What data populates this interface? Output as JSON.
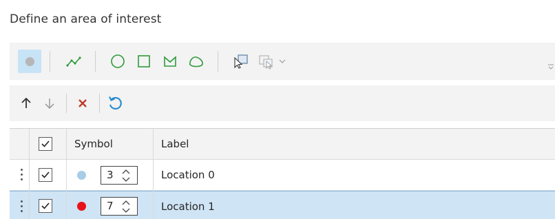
{
  "panel": {
    "title": "Define an area of interest"
  },
  "toolbar": {
    "tools": [
      {
        "name": "point-tool",
        "icon": "point-icon",
        "selected": true
      },
      {
        "name": "line-tool",
        "icon": "polyline-icon"
      },
      {
        "name": "circle-tool",
        "icon": "circle-icon"
      },
      {
        "name": "rectangle-tool",
        "icon": "rectangle-icon"
      },
      {
        "name": "polygon-tool",
        "icon": "polygon-icon"
      },
      {
        "name": "freehand-tool",
        "icon": "freehand-icon"
      },
      {
        "name": "select-tool",
        "icon": "select-icon"
      },
      {
        "name": "select-dropdown-tool",
        "icon": "select-by-shape-icon"
      }
    ],
    "accent": "#c7e3f6"
  },
  "actions": {
    "move_up": "arrow-up-icon",
    "move_down": "arrow-down-icon",
    "delete": "delete-icon",
    "reset": "undo-icon"
  },
  "table": {
    "columns": {
      "symbol": "Symbol",
      "label": "Label"
    },
    "rows": [
      {
        "checked": true,
        "color": "#a8cde6",
        "size": "3",
        "label": "Location 0",
        "selected": false
      },
      {
        "checked": true,
        "color": "#e8121a",
        "size": "7",
        "label": "Location 1",
        "selected": true
      }
    ]
  },
  "colors": {
    "selected_row": "#cfe4f5",
    "delete_red": "#c0392b",
    "reset_blue": "#2b8ccf"
  }
}
